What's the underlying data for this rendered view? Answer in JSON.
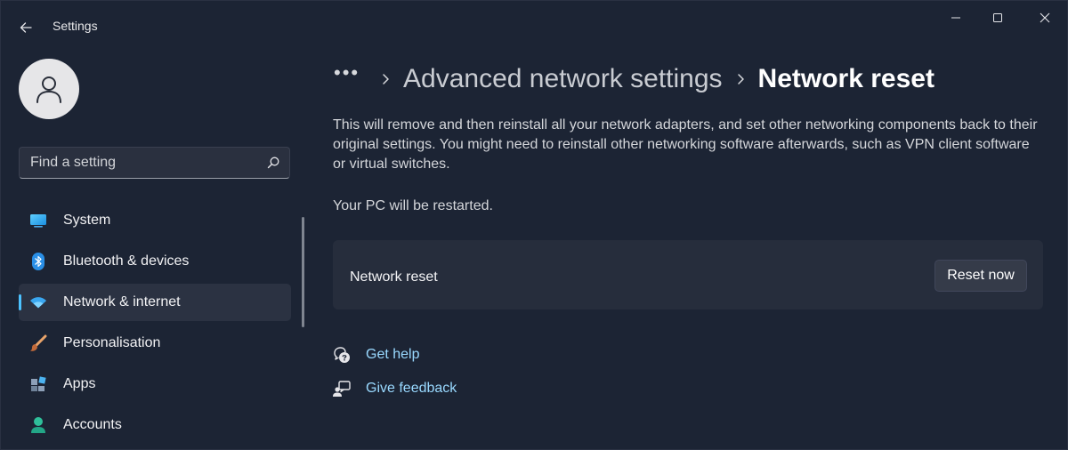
{
  "window": {
    "title": "Settings"
  },
  "profile": {
    "avatar_icon": "person-icon"
  },
  "search": {
    "placeholder": "Find a setting",
    "value": ""
  },
  "sidebar": {
    "items": [
      {
        "label": "System",
        "icon": "monitor-icon",
        "active": false
      },
      {
        "label": "Bluetooth & devices",
        "icon": "bluetooth-icon",
        "active": false
      },
      {
        "label": "Network & internet",
        "icon": "wifi-icon",
        "active": true
      },
      {
        "label": "Personalisation",
        "icon": "paintbrush-icon",
        "active": false
      },
      {
        "label": "Apps",
        "icon": "apps-icon",
        "active": false
      },
      {
        "label": "Accounts",
        "icon": "account-icon",
        "active": false
      }
    ]
  },
  "breadcrumb": {
    "more": "•••",
    "parent": "Advanced network settings",
    "current": "Network reset"
  },
  "content": {
    "description": "This will remove and then reinstall all your network adapters, and set other networking components back to their original settings. You might need to reinstall other networking software afterwards, such as VPN client software or virtual switches.",
    "restart_note": "Your PC will be restarted.",
    "card": {
      "label": "Network reset",
      "button_label": "Reset now"
    },
    "links": [
      {
        "label": "Get help",
        "icon": "help-chat-icon"
      },
      {
        "label": "Give feedback",
        "icon": "feedback-icon"
      }
    ]
  },
  "colors": {
    "background": "#1c2434",
    "accent": "#4cc2ff",
    "link": "#99d9ff",
    "card": "#262d3c"
  }
}
